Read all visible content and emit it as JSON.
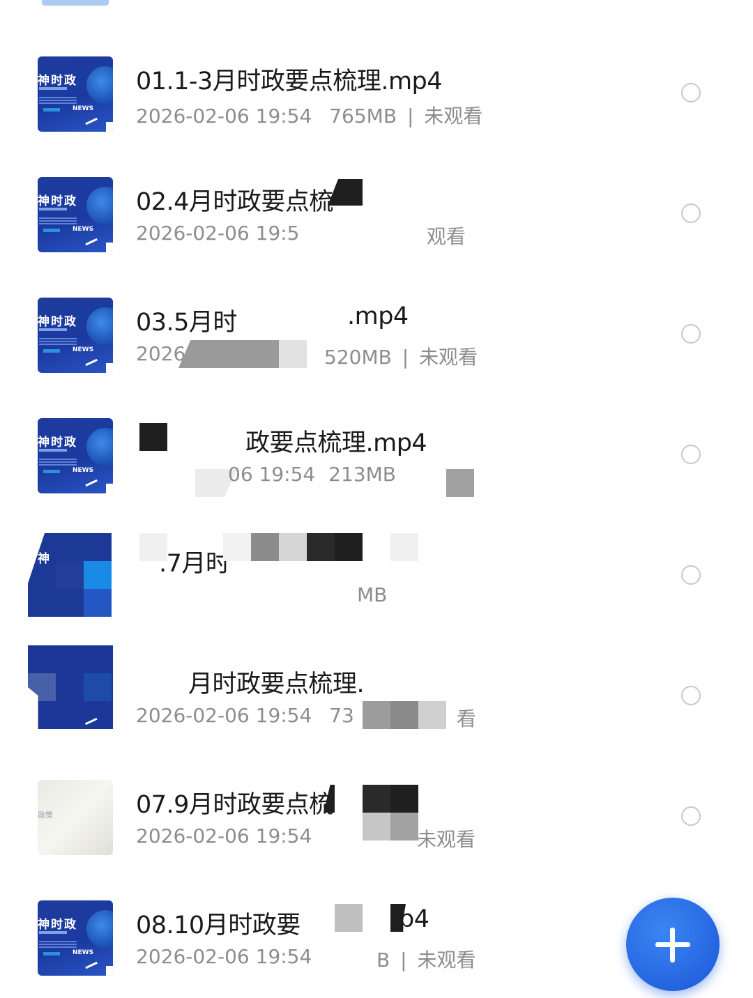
{
  "files": [
    {
      "thumb_title": "神时政",
      "thumb_badge": "NEWS",
      "title": "01.1-3月时政要点梳理.mp4",
      "date": "2026-02-06 19:54",
      "size": "765MB",
      "separator": "|",
      "status": "未观看"
    },
    {
      "thumb_title": "神时政",
      "thumb_badge": "NEWS",
      "title": "02.4月时政要点梳",
      "date": "2026-02-06 19:5",
      "size": "",
      "separator": "",
      "status": "观看"
    },
    {
      "thumb_title": "神时政",
      "thumb_badge": "NEWS",
      "title": "03.5月时",
      "title_tail": ".mp4",
      "date": "2026-",
      "size": "520MB",
      "separator": "|",
      "status": "未观看"
    },
    {
      "thumb_title": "神时政",
      "thumb_badge": "NEWS",
      "title": "政要点梳理.mp4",
      "date": "06 19:54",
      "size": "213MB",
      "separator": "",
      "status": ""
    },
    {
      "thumb_title": "神",
      "thumb_badge": "",
      "title": ".7月时",
      "date": "",
      "size": "MB",
      "separator": "",
      "status": ""
    },
    {
      "thumb_title": "",
      "thumb_badge": "",
      "title": "月时政要点梳理.",
      "date": "2026-02-06 19:54",
      "size": "73",
      "separator": "",
      "status": "看"
    },
    {
      "thumb_title": "政策",
      "thumb_badge": "",
      "title": "07.9月时政要点梳",
      "date": "2026-02-06 19:54",
      "size": "",
      "separator": "",
      "status": "未观看"
    },
    {
      "thumb_title": "神时政",
      "thumb_badge": "NEWS",
      "title": "08.10月时政要",
      "title_tail": "p4",
      "date": "2026-02-06 19:54",
      "size": "B",
      "separator": "|",
      "status": "未观看"
    }
  ],
  "fab": {
    "icon": "plus-icon",
    "color": "#2565e0"
  },
  "colors": {
    "title": "#1a1a1a",
    "meta": "#8d8d8d",
    "circle": "#c8c8c8",
    "thumb_blue": "#1e3c9c"
  }
}
